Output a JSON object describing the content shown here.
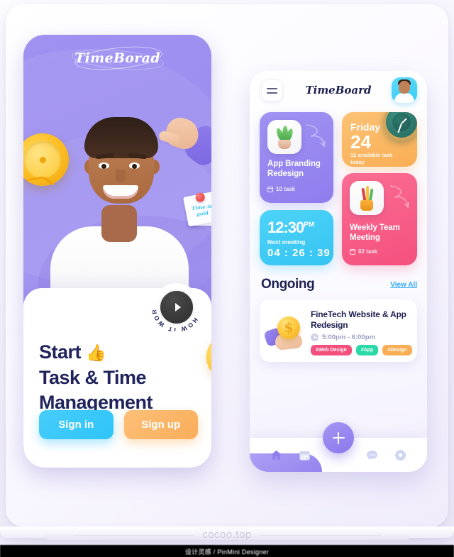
{
  "app": {
    "left_logo": "TimeBorad",
    "right_logo": "TimeBoard"
  },
  "left_phone": {
    "sticky_note": "Time is gold",
    "how_it_works": "HOW IT WORKS",
    "headline_line1": "Start",
    "headline_emoji": "👍",
    "headline_line2": "Task & Time",
    "headline_line3": "Management",
    "buttons": {
      "sign_in": "Sign in",
      "sign_up": "Sign up"
    },
    "icons": {
      "clock": "clock-3d-icon",
      "pointing_hand": "pointing-hand-icon",
      "coin": "dollar-coin-icon",
      "play": "play-icon"
    },
    "colors": {
      "bg_purple": "#9c8ef0",
      "sign_in": "#2fc4f7",
      "sign_up": "#f9ad5a",
      "headline": "#20235c"
    }
  },
  "right_phone": {
    "header": {
      "menu": "menu-icon",
      "title": "TimeBoard",
      "avatar": "user-avatar"
    },
    "cards": [
      {
        "id": "app-branding",
        "title": "App Branding Redesign",
        "meta": "10 task",
        "color": "#8f7ded",
        "icon": "plant-icon"
      },
      {
        "id": "friday-date",
        "day": "Friday",
        "date": "24",
        "meta": "12 available task today",
        "color": "#f9ae55",
        "icon": "alarm-clock-icon"
      },
      {
        "id": "next-meeting",
        "time": "12:30",
        "ampm": "PM",
        "label": "Next meeting",
        "countdown": "04 : 26 : 39",
        "color": "#35c4f2"
      },
      {
        "id": "weekly-team",
        "title": "Weekly Team Meeting",
        "meta": "02 task",
        "color": "#f4507e",
        "icon": "pen-cup-icon"
      }
    ],
    "ongoing": {
      "title": "Ongoing",
      "view_all": "View All",
      "task": {
        "title": "FineTech Website & App Redesign",
        "time": "5:00pm -  6:00pm",
        "tags": [
          {
            "label": "#Web Design",
            "color": "#f4507e"
          },
          {
            "label": "#App",
            "color": "#2bd9a8"
          },
          {
            "label": "#Design",
            "color": "#f9ae55"
          }
        ],
        "icon": "coin-in-hand-icon"
      }
    },
    "nav": {
      "items": [
        {
          "name": "home",
          "icon": "home-icon",
          "active": true
        },
        {
          "name": "calendar",
          "icon": "calendar-icon",
          "active": false
        },
        {
          "name": "add",
          "icon": "plus-icon",
          "active": false
        },
        {
          "name": "chat",
          "icon": "chat-icon",
          "active": false
        },
        {
          "name": "settings",
          "icon": "gear-icon",
          "active": false
        }
      ]
    }
  },
  "footer": {
    "watermark": "cocoo.top",
    "credit": "设计灵感 / PinMini Designer"
  }
}
